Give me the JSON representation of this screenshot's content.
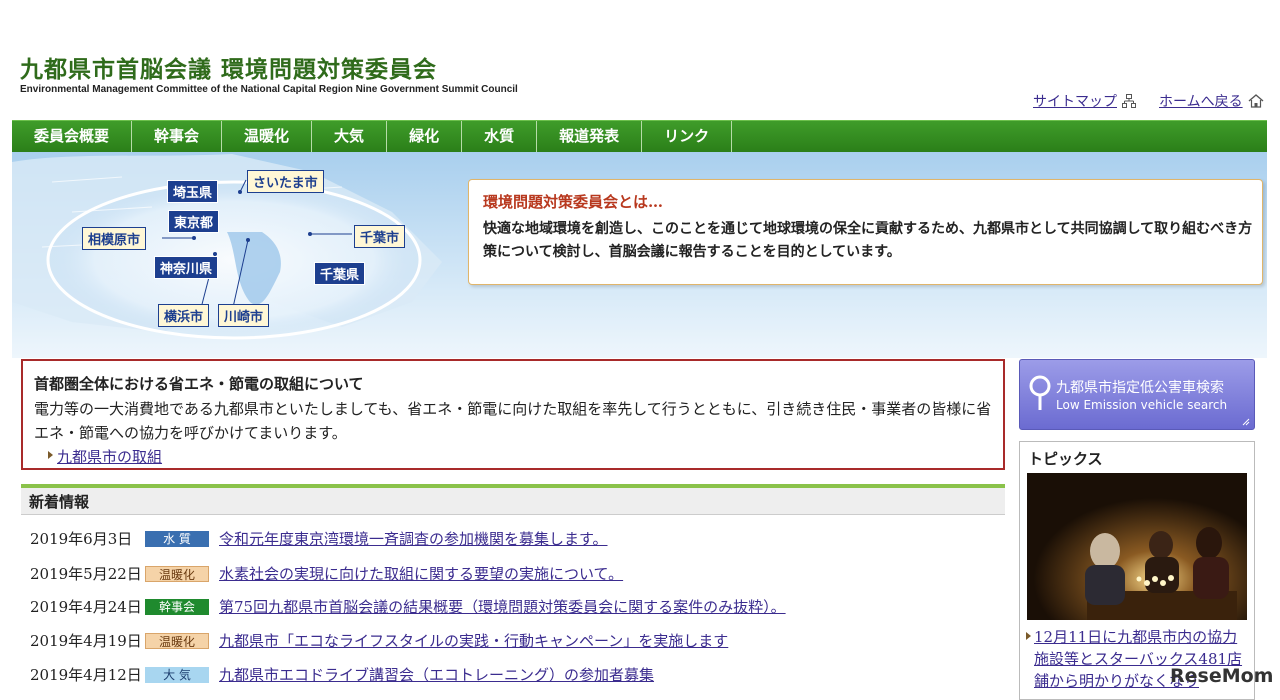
{
  "header": {
    "title": "九都県市首脳会議 環境問題対策委員会",
    "subtitle": "Environmental Management Committee of the National Capital Region Nine Government Summit Council",
    "sitemap": "サイトマップ",
    "home": "ホームへ戻る"
  },
  "nav": {
    "items": [
      "委員会概要",
      "幹事会",
      "温暖化",
      "大気",
      "緑化",
      "水質",
      "報道発表",
      "リンク"
    ]
  },
  "hero": {
    "labels": {
      "saitama_ken": "埼玉県",
      "saitama_shi": "さいたま市",
      "tokyo": "東京都",
      "sagamihara": "相模原市",
      "kanagawa": "神奈川県",
      "chiba_shi": "千葉市",
      "chiba_ken": "千葉県",
      "yokohama": "横浜市",
      "kawasaki": "川崎市"
    },
    "about_title": "環境問題対策委員会とは…",
    "about_text": "快適な地域環境を創造し、このことを通じて地球環境の保全に貢献するため、九都県市として共同協調して取り組むべき方策について検討し、首脳会議に報告することを目的としています。"
  },
  "notice": {
    "title": "首都圏全体における省エネ・節電の取組について",
    "text": "電力等の一大消費地である九都県市といたしましても、省エネ・節電に向けた取組を率先して行うとともに、引き続き住民・事業者の皆様に省エネ・節電への協力を呼びかけてまいります。",
    "link": "九都県市の取組"
  },
  "news": {
    "heading": "新着情報",
    "items": [
      {
        "date": "2019年6月3日",
        "badge": "水 質",
        "title": "令和元年度東京湾環境一斉調査の参加機関を募集します。"
      },
      {
        "date": "2019年5月22日",
        "badge": "温暖化",
        "title": "水素社会の実現に向けた取組に関する要望の実施について。"
      },
      {
        "date": "2019年4月24日",
        "badge": "幹事会",
        "title": "第75回九都県市首脳会議の結果概要（環境問題対策委員会に関する案件のみ抜粋）。"
      },
      {
        "date": "2019年4月19日",
        "badge": "温暖化",
        "title": "九都県市「エコなライフスタイルの実践・行動キャンペーン」を実施します"
      },
      {
        "date": "2019年4月12日",
        "badge": "大 気",
        "title": "九都県市エコドライブ講習会（エコトレーニング）の参加者募集"
      }
    ]
  },
  "sidebar": {
    "search_ja": "九都県市指定低公害車検索",
    "search_en": "Low Emission vehicle search",
    "topics_title": "トピックス",
    "topic_link": "12月11日に九都県市内の協力施設等とスターバックス481店舗から明かりがなくなり"
  },
  "watermark": "ReseMom",
  "colors": {
    "nav_green": "#2f8a1e",
    "title_green": "#2f6b1b",
    "badge_water": "#3a6fb0",
    "badge_warming": "#f5d3a8",
    "badge_kanji": "#1f8a2e",
    "badge_air": "#a8d6f0",
    "notice_border": "#a82a2a",
    "link": "#3b2c8f"
  }
}
